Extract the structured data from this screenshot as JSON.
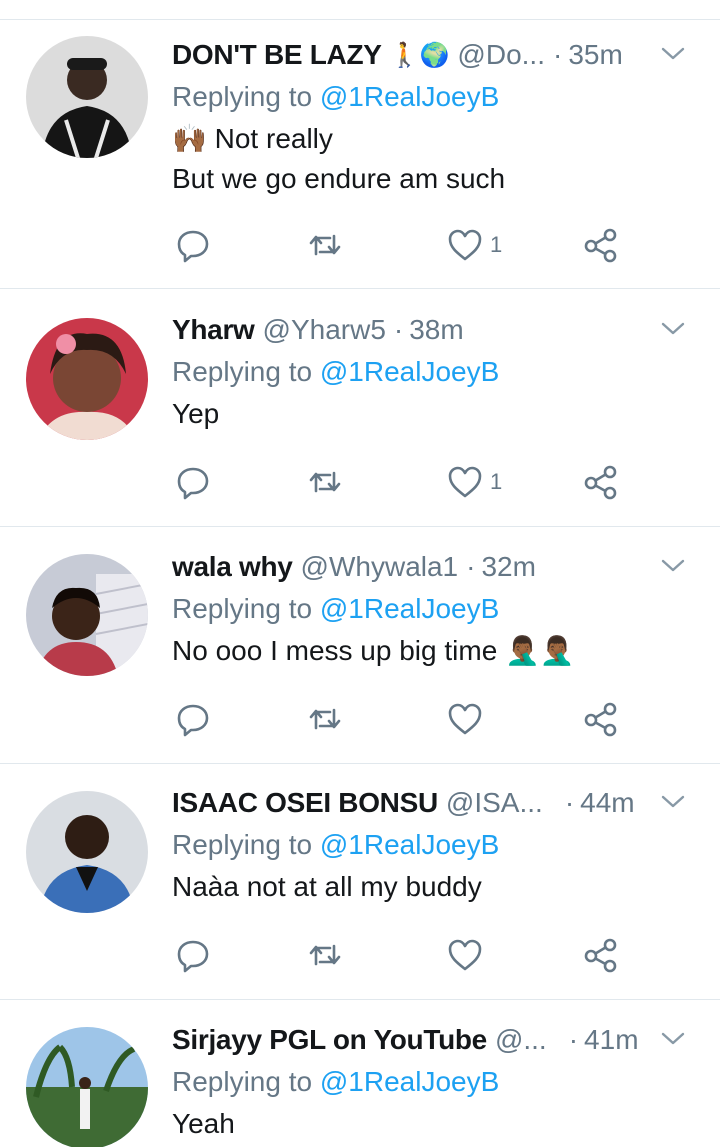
{
  "tweets": [
    {
      "name": "DON'T BE LAZY",
      "name_emoji": "🚶🌍",
      "handle": "@Do...",
      "time": "35m",
      "replying_prefix": "Replying to ",
      "replying_to": "@1RealJoeyB",
      "text_lines": [
        "🙌🏾 Not really",
        "But we go endure am such"
      ],
      "likes": "1"
    },
    {
      "name": "Yharw",
      "name_emoji": "",
      "handle": "@Yharw5",
      "time": "38m",
      "replying_prefix": "Replying to ",
      "replying_to": "@1RealJoeyB",
      "text_lines": [
        "Yep"
      ],
      "likes": "1"
    },
    {
      "name": "wala why",
      "name_emoji": "",
      "handle": "@Whywala1",
      "time": "32m",
      "replying_prefix": "Replying to ",
      "replying_to": "@1RealJoeyB",
      "text_lines": [
        "No ooo I mess up big time 🤦🏾‍♂️🤦🏾‍♂️"
      ],
      "likes": ""
    },
    {
      "name": "ISAAC OSEI BONSU",
      "name_emoji": "",
      "handle": "@ISA...",
      "time": "44m",
      "replying_prefix": "Replying to ",
      "replying_to": "@1RealJoeyB",
      "text_lines": [
        "Naàa not at all my buddy"
      ],
      "likes": ""
    },
    {
      "name": "Sirjayy PGL on YouTube",
      "name_emoji": "",
      "handle": "@...",
      "time": "41m",
      "replying_prefix": "Replying to ",
      "replying_to": "@1RealJoeyB",
      "text_lines": [
        "Yeah"
      ],
      "likes": ""
    }
  ],
  "icons": {
    "reply": "reply-icon",
    "retweet": "retweet-icon",
    "like": "heart-icon",
    "share": "share-icon",
    "menu": "chevron-down-icon"
  },
  "colors": {
    "link": "#1da1f2",
    "secondary": "#657786",
    "icon": "#657786",
    "divider": "#e1e8ed"
  }
}
